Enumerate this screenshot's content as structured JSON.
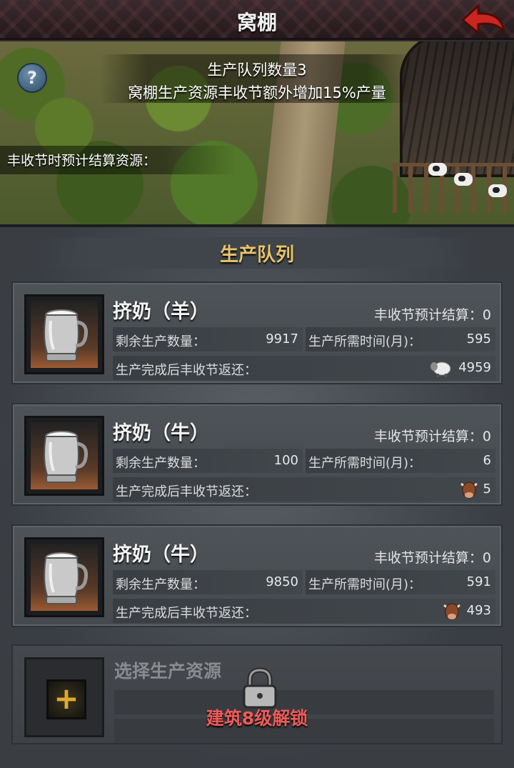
{
  "header": {
    "title": "窝棚"
  },
  "banner": {
    "queue_count_text": "生产队列数量3",
    "bonus_text": "窝棚生产资源丰收节额外增加15%产量",
    "forecast_label": "丰收节时预计结算资源："
  },
  "section": {
    "title": "生产队列"
  },
  "queue": [
    {
      "title": "挤奶（羊）",
      "settle_text": "丰收节预计结算：0",
      "remaining_label": "剩余生产数量：",
      "remaining_value": "9917",
      "time_label": "生产所需时间(月)：",
      "time_value": "595",
      "return_label": "生产完成后丰收节返还：",
      "return_value": "4959",
      "return_icon": "sheep-icon"
    },
    {
      "title": "挤奶（牛）",
      "settle_text": "丰收节预计结算：0",
      "remaining_label": "剩余生产数量：",
      "remaining_value": "100",
      "time_label": "生产所需时间(月)：",
      "time_value": "6",
      "return_label": "生产完成后丰收节返还：",
      "return_value": "5",
      "return_icon": "cow-icon"
    },
    {
      "title": "挤奶（牛）",
      "settle_text": "丰收节预计结算：0",
      "remaining_label": "剩余生产数量：",
      "remaining_value": "9850",
      "time_label": "生产所需时间(月)：",
      "time_value": "591",
      "return_label": "生产完成后丰收节返还：",
      "return_value": "493",
      "return_icon": "cow-icon"
    }
  ],
  "locked_slot": {
    "title": "选择生产资源",
    "unlock_text": "建筑8级解锁"
  }
}
